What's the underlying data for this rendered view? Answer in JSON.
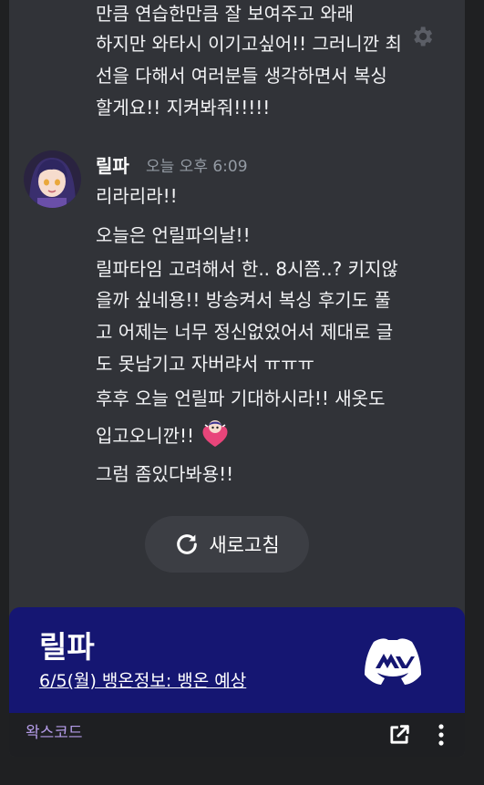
{
  "messages": {
    "previous": {
      "lines": [
        "만큼 연습한만큼 잘 보여주고 와래",
        "하지만 와타시 이기고싶어!! 그러니깐 최",
        "선을 다해서 여러분들 생각하면서 복싱",
        "할게요!! 지켜봐줘!!!!!"
      ]
    },
    "current": {
      "author": "릴파",
      "timestamp": "오늘 오후 6:09",
      "lines": [
        "리라리라!!",
        "오늘은 언릴파의날!!",
        "릴파타임 고려해서 한.. 8시쯤..? 키지않",
        "을까 싶네용!! 방송켜서 복싱 후기도 풀",
        "고 어제는 너무 정신없었어서 제대로 글",
        "도 못남기고 자버랴서 ㅠㅠㅠ",
        "후후 오늘 언릴파 기대하시라!! 새옷도",
        "입고오니깐!!",
        "그럼 좀있다봐용!!"
      ]
    }
  },
  "refresh": {
    "label": "새로고침",
    "icon": "refresh-icon"
  },
  "banner": {
    "server_name": "릴파",
    "event_link": "6/5(월) 뱅온정보: 뱅온 예상",
    "background": "#151672"
  },
  "footer": {
    "label": "왁스코드",
    "open_icon": "open-external-icon",
    "more_icon": "more-vertical-icon"
  },
  "icons": {
    "settings": "gear-icon",
    "emoji": "heart-character-emoji"
  },
  "colors": {
    "message_bg": "#313338",
    "text": "#f2f3f5",
    "muted": "#949ba4",
    "footer_text": "#b49ce8"
  }
}
